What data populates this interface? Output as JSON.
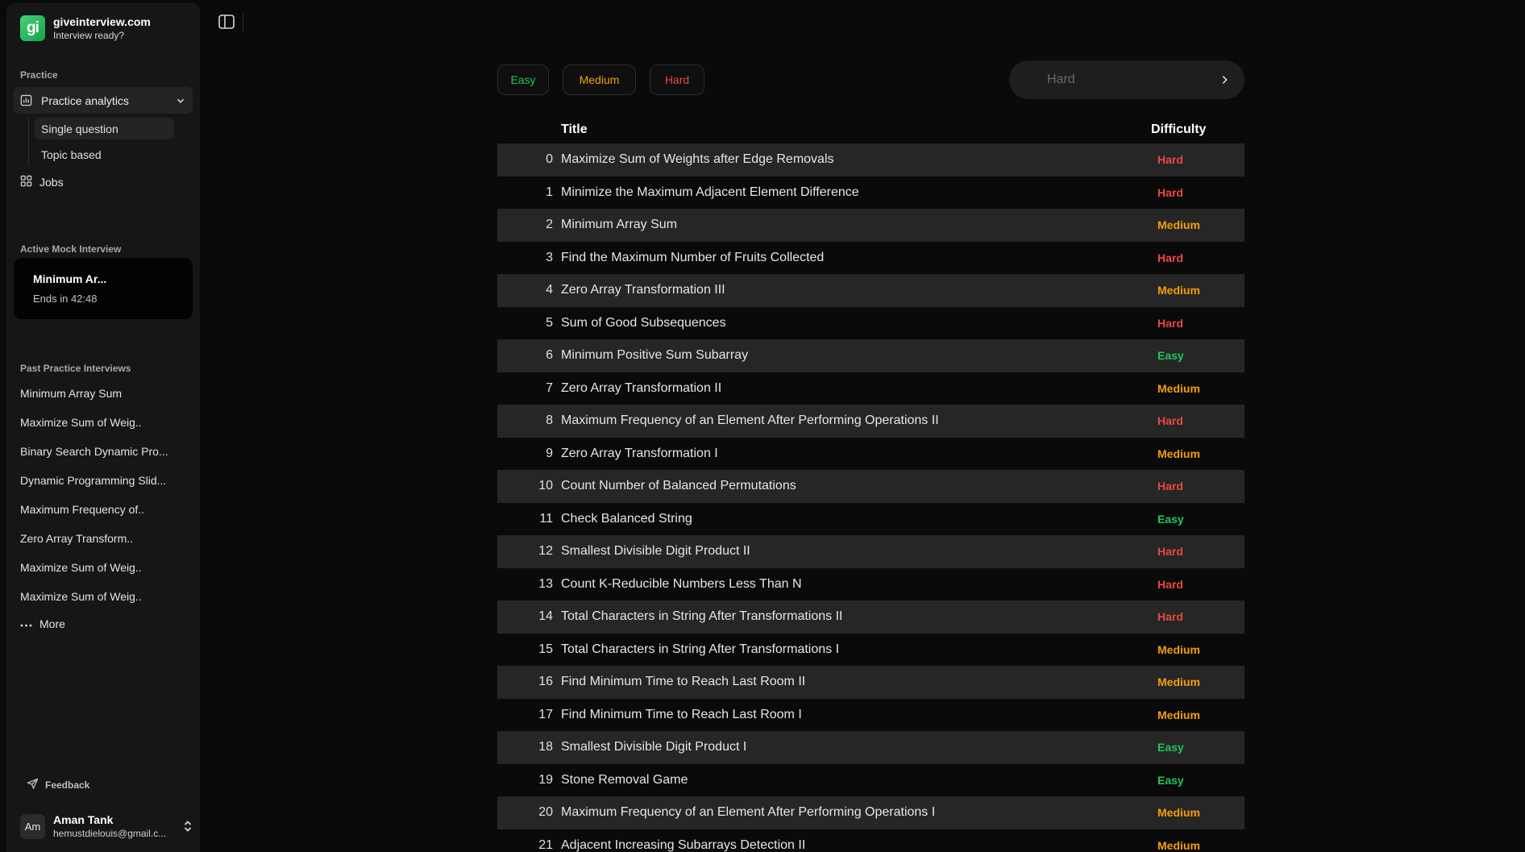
{
  "brand": {
    "name": "giveinterview.com",
    "tagline": "Interview ready?",
    "logo_text": "gi"
  },
  "sidebar": {
    "practice_label": "Practice",
    "practice_analytics": "Practice analytics",
    "sub_items": [
      "Single question",
      "Topic based"
    ],
    "jobs": "Jobs",
    "active_label": "Active Mock Interview",
    "active_card": {
      "title": "Minimum Ar...",
      "ends": "Ends in 42:48"
    },
    "past_label": "Past Practice Interviews",
    "past_items": [
      "Minimum Array Sum",
      "Maximize Sum of Weig..",
      "Binary Search Dynamic Pro...",
      "Dynamic Programming Slid...",
      "Maximum Frequency of..",
      "Zero Array Transform..",
      "Maximize Sum of Weig..",
      "Maximize Sum of Weig.."
    ],
    "more": "More",
    "feedback": "Feedback",
    "user": {
      "initials": "Am",
      "name": "Aman Tank",
      "email": "hemustdielouis@gmail.c..."
    }
  },
  "filters": {
    "chips": [
      {
        "label": "Easy",
        "color": "#22c55e"
      },
      {
        "label": "Medium",
        "color": "#f59e0b"
      },
      {
        "label": "Hard",
        "color": "#ef4444"
      }
    ],
    "search_placeholder": "Hard"
  },
  "table": {
    "headers": {
      "title": "Title",
      "difficulty": "Difficulty"
    },
    "rows": [
      {
        "idx": "0",
        "title": "Maximize Sum of Weights after Edge Removals",
        "difficulty": "Hard"
      },
      {
        "idx": "1",
        "title": "Minimize the Maximum Adjacent Element Difference",
        "difficulty": "Hard"
      },
      {
        "idx": "2",
        "title": "Minimum Array Sum",
        "difficulty": "Medium"
      },
      {
        "idx": "3",
        "title": "Find the Maximum Number of Fruits Collected",
        "difficulty": "Hard"
      },
      {
        "idx": "4",
        "title": "Zero Array Transformation III",
        "difficulty": "Medium"
      },
      {
        "idx": "5",
        "title": "Sum of Good Subsequences",
        "difficulty": "Hard"
      },
      {
        "idx": "6",
        "title": "Minimum Positive Sum Subarray",
        "difficulty": "Easy"
      },
      {
        "idx": "7",
        "title": "Zero Array Transformation II",
        "difficulty": "Medium"
      },
      {
        "idx": "8",
        "title": "Maximum Frequency of an Element After Performing Operations II",
        "difficulty": "Hard"
      },
      {
        "idx": "9",
        "title": "Zero Array Transformation I",
        "difficulty": "Medium"
      },
      {
        "idx": "10",
        "title": "Count Number of Balanced Permutations",
        "difficulty": "Hard"
      },
      {
        "idx": "11",
        "title": "Check Balanced String",
        "difficulty": "Easy"
      },
      {
        "idx": "12",
        "title": "Smallest Divisible Digit Product II",
        "difficulty": "Hard"
      },
      {
        "idx": "13",
        "title": "Count K-Reducible Numbers Less Than N",
        "difficulty": "Hard"
      },
      {
        "idx": "14",
        "title": "Total Characters in String After Transformations II",
        "difficulty": "Hard"
      },
      {
        "idx": "15",
        "title": "Total Characters in String After Transformations I",
        "difficulty": "Medium"
      },
      {
        "idx": "16",
        "title": "Find Minimum Time to Reach Last Room II",
        "difficulty": "Medium"
      },
      {
        "idx": "17",
        "title": "Find Minimum Time to Reach Last Room I",
        "difficulty": "Medium"
      },
      {
        "idx": "18",
        "title": "Smallest Divisible Digit Product I",
        "difficulty": "Easy"
      },
      {
        "idx": "19",
        "title": "Stone Removal Game",
        "difficulty": "Easy"
      },
      {
        "idx": "20",
        "title": "Maximum Frequency of an Element After Performing Operations I",
        "difficulty": "Medium"
      },
      {
        "idx": "21",
        "title": "Adjacent Increasing Subarrays Detection II",
        "difficulty": "Medium"
      }
    ]
  },
  "colors": {
    "hard": "#ef4444",
    "medium": "#f59e0b",
    "easy": "#22c55e",
    "accent": "#22c55e"
  }
}
